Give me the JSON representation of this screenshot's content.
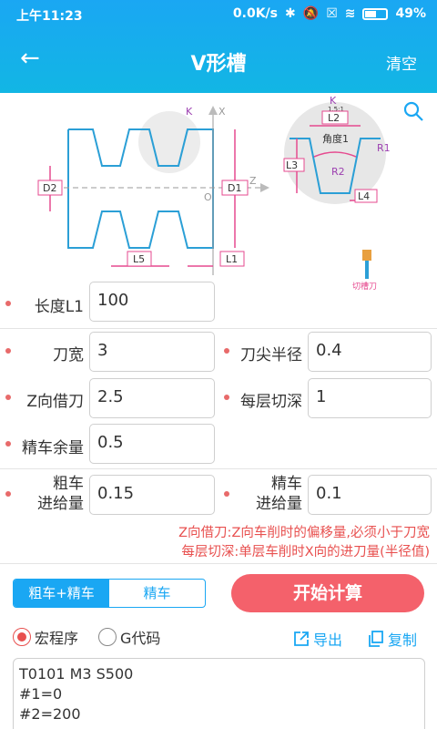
{
  "status": {
    "time": "上午11:23",
    "speed": "0.0K/s",
    "battery": "49"
  },
  "header": {
    "title": "V形槽",
    "clear_label": "清空"
  },
  "diagram": {
    "labels": {
      "k_left": "K",
      "x_axis": "X",
      "z_axis": "Z",
      "origin": "O",
      "d1": "D1",
      "d2": "D2",
      "l1": "L1",
      "l5": "L5",
      "k_right": "K",
      "ratio": "1.5:1",
      "l2": "L2",
      "l3": "L3",
      "l4": "L4",
      "angle": "角度1",
      "r1": "R1",
      "r2": "R2",
      "tool": "切槽刀"
    }
  },
  "fields": {
    "length_l1": {
      "label": "长度L1",
      "value": "100"
    },
    "tool_width": {
      "label": "刀宽",
      "value": "3"
    },
    "nose_radius": {
      "label": "刀尖半径",
      "value": "0.4"
    },
    "z_offset": {
      "label": "Z向借刀",
      "value": "2.5"
    },
    "cut_depth": {
      "label": "每层切深",
      "value": "1"
    },
    "finish_allow": {
      "label": "精车余量",
      "value": "0.5"
    },
    "rough_feed": {
      "label_1": "粗车",
      "label_2": "进给量",
      "value": "0.15"
    },
    "finish_feed": {
      "label_1": "精车",
      "label_2": "进给量",
      "value": "0.1"
    }
  },
  "hints": {
    "line1": "Z向借刀:Z向车削时的偏移量,必须小于刀宽",
    "line2": "每层切深:单层车削时X向的进刀量(半径值)"
  },
  "controls": {
    "mode_rough_finish": "粗车+精车",
    "mode_finish": "精车",
    "calculate": "开始计算",
    "radio_macro": "宏程序",
    "radio_gcode": "G代码",
    "export": "导出",
    "copy": "复制"
  },
  "code": {
    "line1": "T0101 M3 S500",
    "line2": "#1=0",
    "line3": "#2=200"
  },
  "colors": {
    "primary": "#1aa7f3",
    "accent": "#f4616b",
    "hint": "#e8504f",
    "dim": "#e64a8f"
  }
}
